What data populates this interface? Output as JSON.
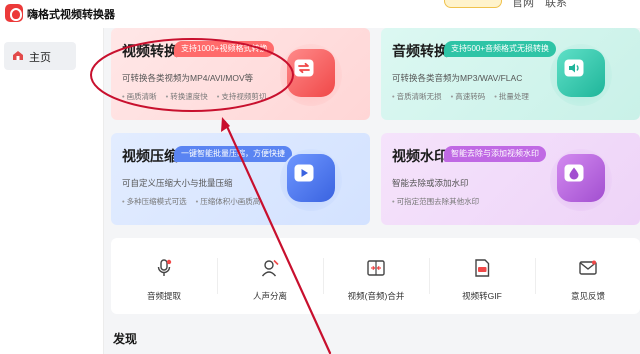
{
  "app": {
    "title": "嗨格式视频转换器"
  },
  "topbar": {
    "links": [
      "官网",
      "联系"
    ]
  },
  "sidebar": {
    "items": [
      {
        "label": "主页",
        "icon": "home-icon"
      }
    ]
  },
  "cards": [
    {
      "title": "视频转换",
      "tag": "支持1000+视频格式转换",
      "desc": "可转换各类视频为MP4/AVI/MOV等",
      "features": [
        "画质清晰",
        "转换速度快",
        "支持视频剪切"
      ],
      "icon": "video-convert-icon"
    },
    {
      "title": "音频转换",
      "tag": "支持500+音频格式无损转换",
      "desc": "可转换各类音频为MP3/WAV/FLAC",
      "features": [
        "音质清晰无损",
        "高速转码",
        "批量处理"
      ],
      "icon": "audio-convert-icon"
    },
    {
      "title": "视频压缩",
      "tag": "一键智能批量压缩，方便快捷",
      "desc": "可自定义压缩大小与批量压缩",
      "features": [
        "多种压缩模式可选",
        "压缩体积小画质高"
      ],
      "icon": "video-compress-icon"
    },
    {
      "title": "视频水印",
      "tag": "智能去除与添加视频水印",
      "desc": "智能去除或添加水印",
      "features": [
        "可指定范围去除其他水印"
      ],
      "icon": "watermark-icon"
    }
  ],
  "tools": [
    {
      "label": "音频提取",
      "icon": "audio-extract-icon"
    },
    {
      "label": "人声分离",
      "icon": "vocal-separate-icon"
    },
    {
      "label": "视频(音频)合并",
      "icon": "merge-icon"
    },
    {
      "label": "视频转GIF",
      "icon": "gif-icon"
    },
    {
      "label": "意见反馈",
      "icon": "feedback-icon"
    }
  ],
  "section": {
    "discover_title": "发现"
  },
  "annotation": {
    "color": "#c8102e",
    "shape": "ellipse-with-arrow",
    "target": "视频转换"
  }
}
